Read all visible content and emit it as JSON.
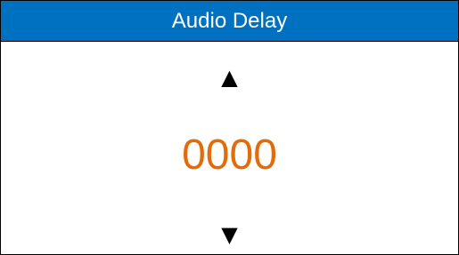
{
  "header": {
    "title": "Audio Delay"
  },
  "controls": {
    "up_arrow": "▲",
    "down_arrow": "▼"
  },
  "delay": {
    "value": "0000"
  },
  "colors": {
    "title_bar": "#0070c0",
    "title_text": "#ffffff",
    "value_text": "#e36c0a",
    "arrows": "#000000"
  }
}
